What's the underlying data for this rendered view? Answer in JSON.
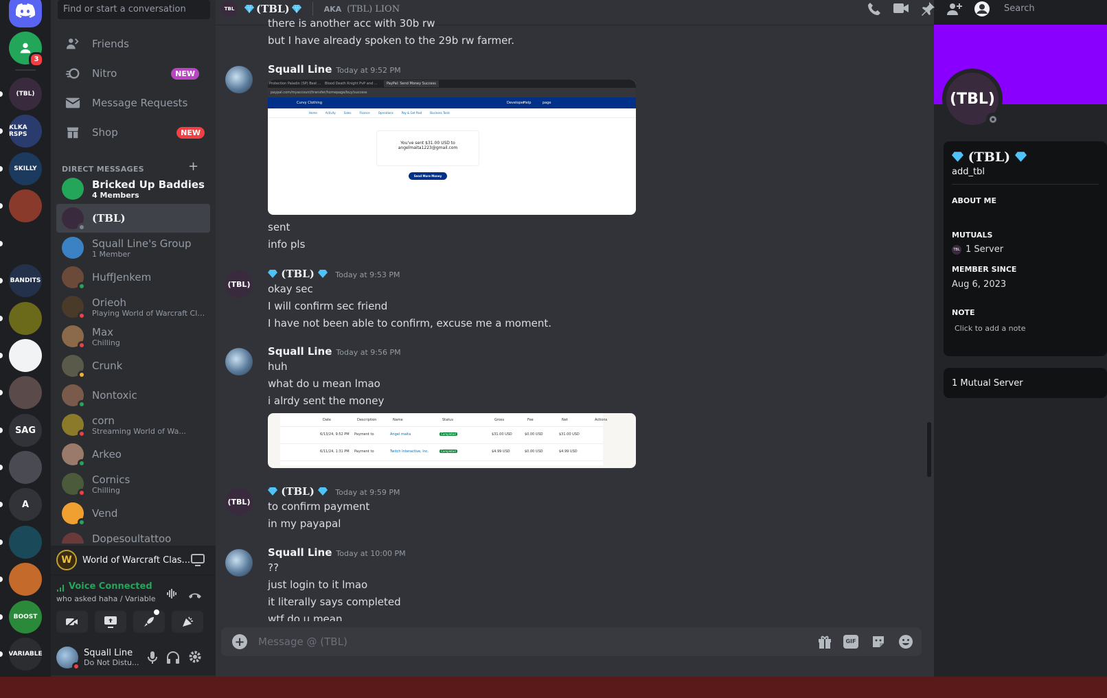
{
  "servers": {
    "home_label": "Direct Messages",
    "friends_badge": "3",
    "items": [
      {
        "label": "(TBL)",
        "color": "#3a2a3e"
      },
      {
        "label": "KLKA RSPS",
        "color": "#2a3b6e"
      },
      {
        "label": "SKILLY",
        "color": "#1b3a5e"
      },
      {
        "label": "",
        "color": "#8a3a2a"
      },
      {
        "label": "",
        "color": "#1e1f22"
      },
      {
        "label": "BANDITS",
        "color": "#23324a"
      },
      {
        "label": "",
        "color": "#6b6a1a"
      },
      {
        "label": "",
        "color": "#f2f3f5"
      },
      {
        "label": "",
        "color": "#5a4a4a"
      },
      {
        "label": "SAG",
        "color": "#313338"
      },
      {
        "label": "",
        "color": "#4a4a52"
      },
      {
        "label": "A",
        "color": "#313338"
      },
      {
        "label": "",
        "color": "#1a4a5a"
      },
      {
        "label": "",
        "color": "#c46a2a"
      },
      {
        "label": "BOOST",
        "color": "#2a8a3a"
      },
      {
        "label": "VARIABLE",
        "color": "#2b2d31"
      }
    ]
  },
  "sidebar": {
    "search_placeholder": "Find or start a conversation",
    "nav": {
      "friends": "Friends",
      "nitro": "Nitro",
      "nitro_badge": "NEW",
      "requests": "Message Requests",
      "shop": "Shop",
      "shop_badge": "NEW"
    },
    "dm_header": "DIRECT MESSAGES",
    "dms": [
      {
        "name": "Bricked Up Baddies",
        "sub": "4 Members",
        "color": "#23a55a"
      },
      {
        "name": "(TBL)",
        "sub": "",
        "color": "#3a2a3e"
      },
      {
        "name": "Squall Line's Group",
        "sub": "1 Member",
        "color": "#3b82c4"
      },
      {
        "name": "HuffJenkem",
        "sub": "",
        "color": "#6b4a3a"
      },
      {
        "name": "Orieoh",
        "sub": "Playing World of Warcraft Cla...",
        "color": "#4a3a2a"
      },
      {
        "name": "Max",
        "sub": "Chilling",
        "color": "#8a6a4a"
      },
      {
        "name": "Crunk",
        "sub": "",
        "color": "#5a5a4a"
      },
      {
        "name": "Nontoxic",
        "sub": "",
        "color": "#7a5a4a"
      },
      {
        "name": "corn",
        "sub": "Streaming World of Wa...",
        "color": "#8a7a2a"
      },
      {
        "name": "Arkeo",
        "sub": "",
        "color": "#9a7a6a"
      },
      {
        "name": "Cornics",
        "sub": "Chilling",
        "color": "#4a5a3a"
      },
      {
        "name": "Vend",
        "sub": "",
        "color": "#f0a030"
      },
      {
        "name": "Dopesoultattoo",
        "sub": "",
        "color": "#6a3a3a"
      }
    ],
    "activity": "World of Warcraft Clas...",
    "voice": {
      "status": "Voice Connected",
      "channel": "who asked haha / Variable"
    },
    "user": {
      "name": "Squall Line",
      "status": "Do Not Distu..."
    }
  },
  "header": {
    "name": "(TBL)",
    "aka_label": "AKA",
    "aka_value": "(TBL) LION",
    "search": "Search"
  },
  "messages": {
    "m0": {
      "l1": "there is another acc with 30b rw",
      "l2": "but I have already spoken to the 29b rw farmer."
    },
    "m1": {
      "author": "Squall Line",
      "time": "Today at 9:52 PM",
      "l1": "sent",
      "l2": "info pls"
    },
    "m2": {
      "author": "(TBL)",
      "time": "Today at 9:53 PM",
      "l1": "okay sec",
      "l2": "I will confirm sec friend",
      "l3": "I have not been able to confirm, excuse me a moment."
    },
    "m3": {
      "author": "Squall Line",
      "time": "Today at 9:56 PM",
      "l1": "huh",
      "l2": "what do u mean lmao",
      "l3": "i alrdy sent the money"
    },
    "m4": {
      "author": "(TBL)",
      "time": "Today at 9:59 PM",
      "l1": "to confirm payment",
      "l2": "in my payapal"
    },
    "m5": {
      "author": "Squall Line",
      "time": "Today at 10:00 PM",
      "l1": "??",
      "l2": "just login to it lmao",
      "l3": "it literally says completed",
      "l4": "wtf do u mean"
    }
  },
  "paypal_shot": {
    "tab1": "Protection Paladin (SP) Best ...",
    "tab2": "Blood Death Knight PvP and ...",
    "tab3": "PayPal: Send Money Success",
    "url": "paypal.com/myaccount/transfer/homepage/buy/success",
    "brand": "Curvy Clothing",
    "nav": [
      "Home",
      "Activity",
      "Sales",
      "Finance",
      "Operations",
      "Pay & Get Paid",
      "Business Tools"
    ],
    "right": [
      "Developer",
      "Help",
      "page"
    ],
    "sent_line1": "You've sent $31.00 USD to",
    "sent_line2": "angelmaita1223@gmail.com",
    "button": "Send More Money"
  },
  "tx_table": {
    "headers": [
      "Date",
      "Description",
      "Name",
      "Status",
      "Gross",
      "Fee",
      "Net",
      "Actions"
    ],
    "rows": [
      {
        "date": "6/13/24, 9:52 PM",
        "desc": "Payment to",
        "name": "Angel maita",
        "status": "Completed",
        "gross": "$31.00 USD",
        "fee": "$0.00 USD",
        "net": "$31.00 USD"
      },
      {
        "date": "6/11/24, 1:31 PM",
        "desc": "Payment to",
        "name": "Twitch Interactive, Inc.",
        "status": "Completed",
        "gross": "$4.99 USD",
        "fee": "$0.00 USD",
        "net": "$4.99 USD"
      }
    ]
  },
  "composer": {
    "placeholder": "Message @ (TBL)",
    "gif": "GIF"
  },
  "profile": {
    "banner_color": "#8a00ff",
    "avatar_label": "(TBL)",
    "display_name": "(TBL)",
    "username": "add_tbl",
    "about_label": "ABOUT ME",
    "mutuals_label": "MUTUALS",
    "mutual_server_count": "1 Server",
    "member_since_label": "MEMBER SINCE",
    "member_since": "Aug 6, 2023",
    "note_label": "NOTE",
    "note_placeholder": "Click to add a note",
    "mutual_servers": "1 Mutual Server"
  },
  "colors": {
    "accent": "#5865f2",
    "online": "#23a55a",
    "dnd": "#f23f43",
    "nitro": "#b845c1",
    "link": "#00a8fc"
  }
}
